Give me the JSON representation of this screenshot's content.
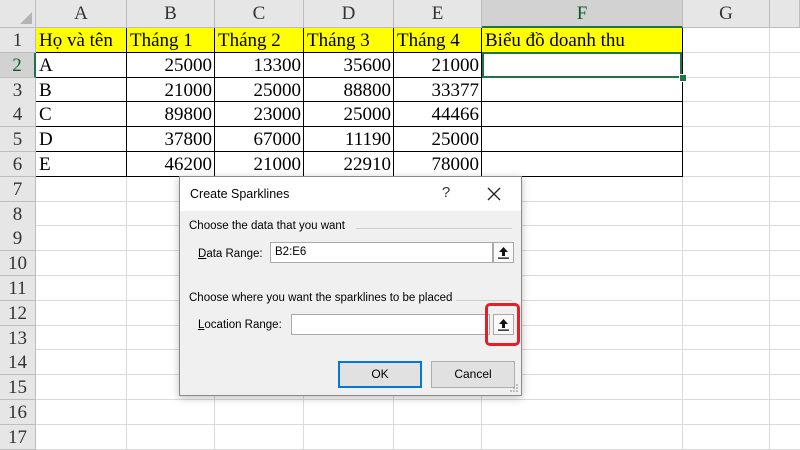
{
  "sheet": {
    "columns": [
      "A",
      "B",
      "C",
      "D",
      "E",
      "F",
      "G"
    ],
    "rows": [
      "1",
      "2",
      "3",
      "4",
      "5",
      "6",
      "7",
      "8",
      "9",
      "10",
      "11",
      "12",
      "13",
      "14",
      "15",
      "16",
      "17"
    ],
    "selected_column": "F",
    "selected_row": "2",
    "headers": [
      "Họ và tên",
      "Tháng 1",
      "Tháng 2",
      "Tháng 3",
      "Tháng 4",
      "Biểu đồ doanh thu"
    ],
    "data": [
      [
        "A",
        "25000",
        "13300",
        "35600",
        "21000",
        ""
      ],
      [
        "B",
        "21000",
        "25000",
        "88800",
        "33377",
        ""
      ],
      [
        "C",
        "89800",
        "23000",
        "25000",
        "44466",
        ""
      ],
      [
        "D",
        "37800",
        "67000",
        "11190",
        "25000",
        ""
      ],
      [
        "E",
        "46200",
        "21000",
        "22910",
        "78000",
        ""
      ]
    ],
    "header_fill": "#ffff00",
    "selection_color": "#217346"
  },
  "dialog": {
    "title": "Create Sparklines",
    "help": "?",
    "close_icon": "close-icon",
    "section1": "Choose the data that you want",
    "data_range_label_u": "D",
    "data_range_label_rest": "ata Range:",
    "data_range_value": "B2:E6",
    "section2": "Choose where you want the sparklines to be placed",
    "location_label_u": "L",
    "location_label_rest": "ocation Range:",
    "location_value": "",
    "ok": "OK",
    "cancel": "Cancel",
    "highlight_color": "#e0202a"
  }
}
